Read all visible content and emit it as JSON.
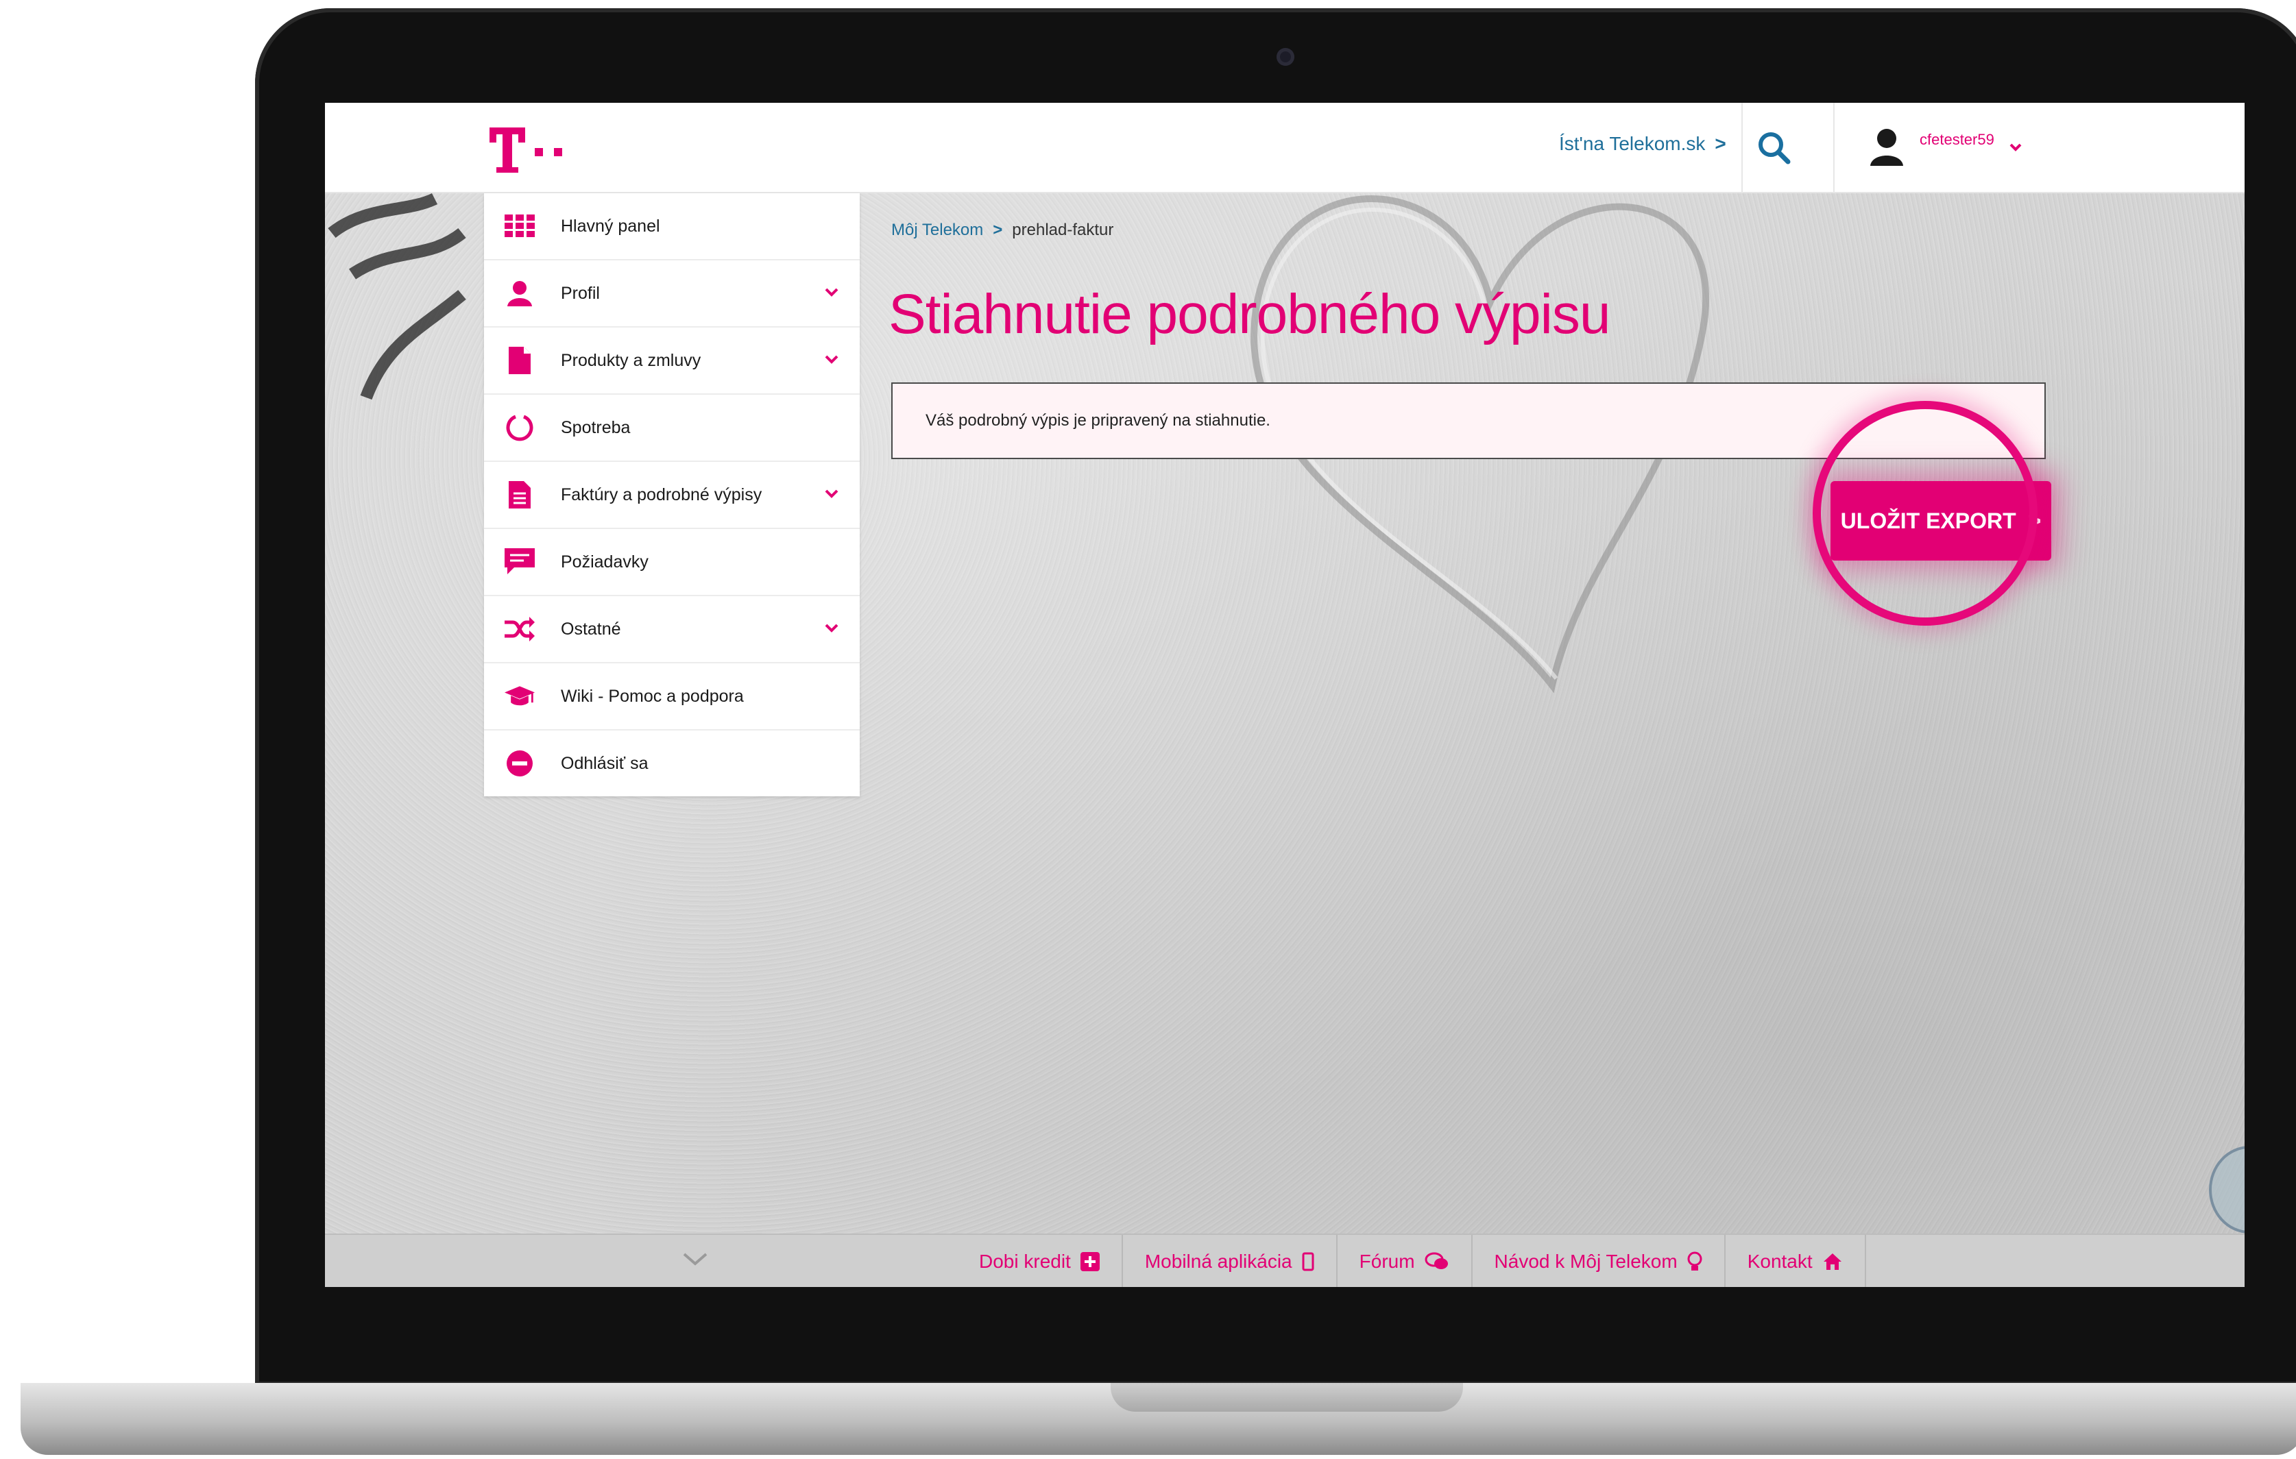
{
  "header": {
    "go_link_label": "Íst'na Telekom.sk",
    "username": "cfetester59"
  },
  "sidebar": {
    "items": [
      {
        "label": "Hlavný panel",
        "icon": "grid-icon",
        "has_chevron": false
      },
      {
        "label": "Profil",
        "icon": "user-icon",
        "has_chevron": true
      },
      {
        "label": "Produkty a zmluvy",
        "icon": "document-icon",
        "has_chevron": true
      },
      {
        "label": "Spotreba",
        "icon": "ring-icon",
        "has_chevron": false
      },
      {
        "label": "Faktúry a podrobné výpisy",
        "icon": "invoice-icon",
        "has_chevron": true
      },
      {
        "label": "Požiadavky",
        "icon": "chat-icon",
        "has_chevron": false
      },
      {
        "label": "Ostatné",
        "icon": "shuffle-icon",
        "has_chevron": true
      },
      {
        "label": "Wiki - Pomoc a podpora",
        "icon": "graduation-cap-icon",
        "has_chevron": false
      },
      {
        "label": "Odhlásiť sa",
        "icon": "minus-circle-icon",
        "has_chevron": false
      }
    ]
  },
  "breadcrumb": {
    "root": "Môj Telekom",
    "current": "prehlad-faktur"
  },
  "main": {
    "title": "Stiahnutie podrobného výpisu",
    "notice": "Váš podrobný výpis je pripravený na stiahnutie.",
    "export_button": "ULOŽIT EXPORT"
  },
  "footer": {
    "links": [
      {
        "label": "Dobi kredit",
        "icon": "plus-square-icon"
      },
      {
        "label": "Mobilná aplikácia",
        "icon": "phone-icon"
      },
      {
        "label": "Fórum",
        "icon": "chat-bubbles-icon"
      },
      {
        "label": "Návod k Môj Telekom",
        "icon": "lightbulb-icon"
      },
      {
        "label": "Kontakt",
        "icon": "home-icon"
      }
    ]
  },
  "colors": {
    "brand": "#e20074",
    "link": "#1f6f9a",
    "notice_bg": "#fff3f6"
  }
}
